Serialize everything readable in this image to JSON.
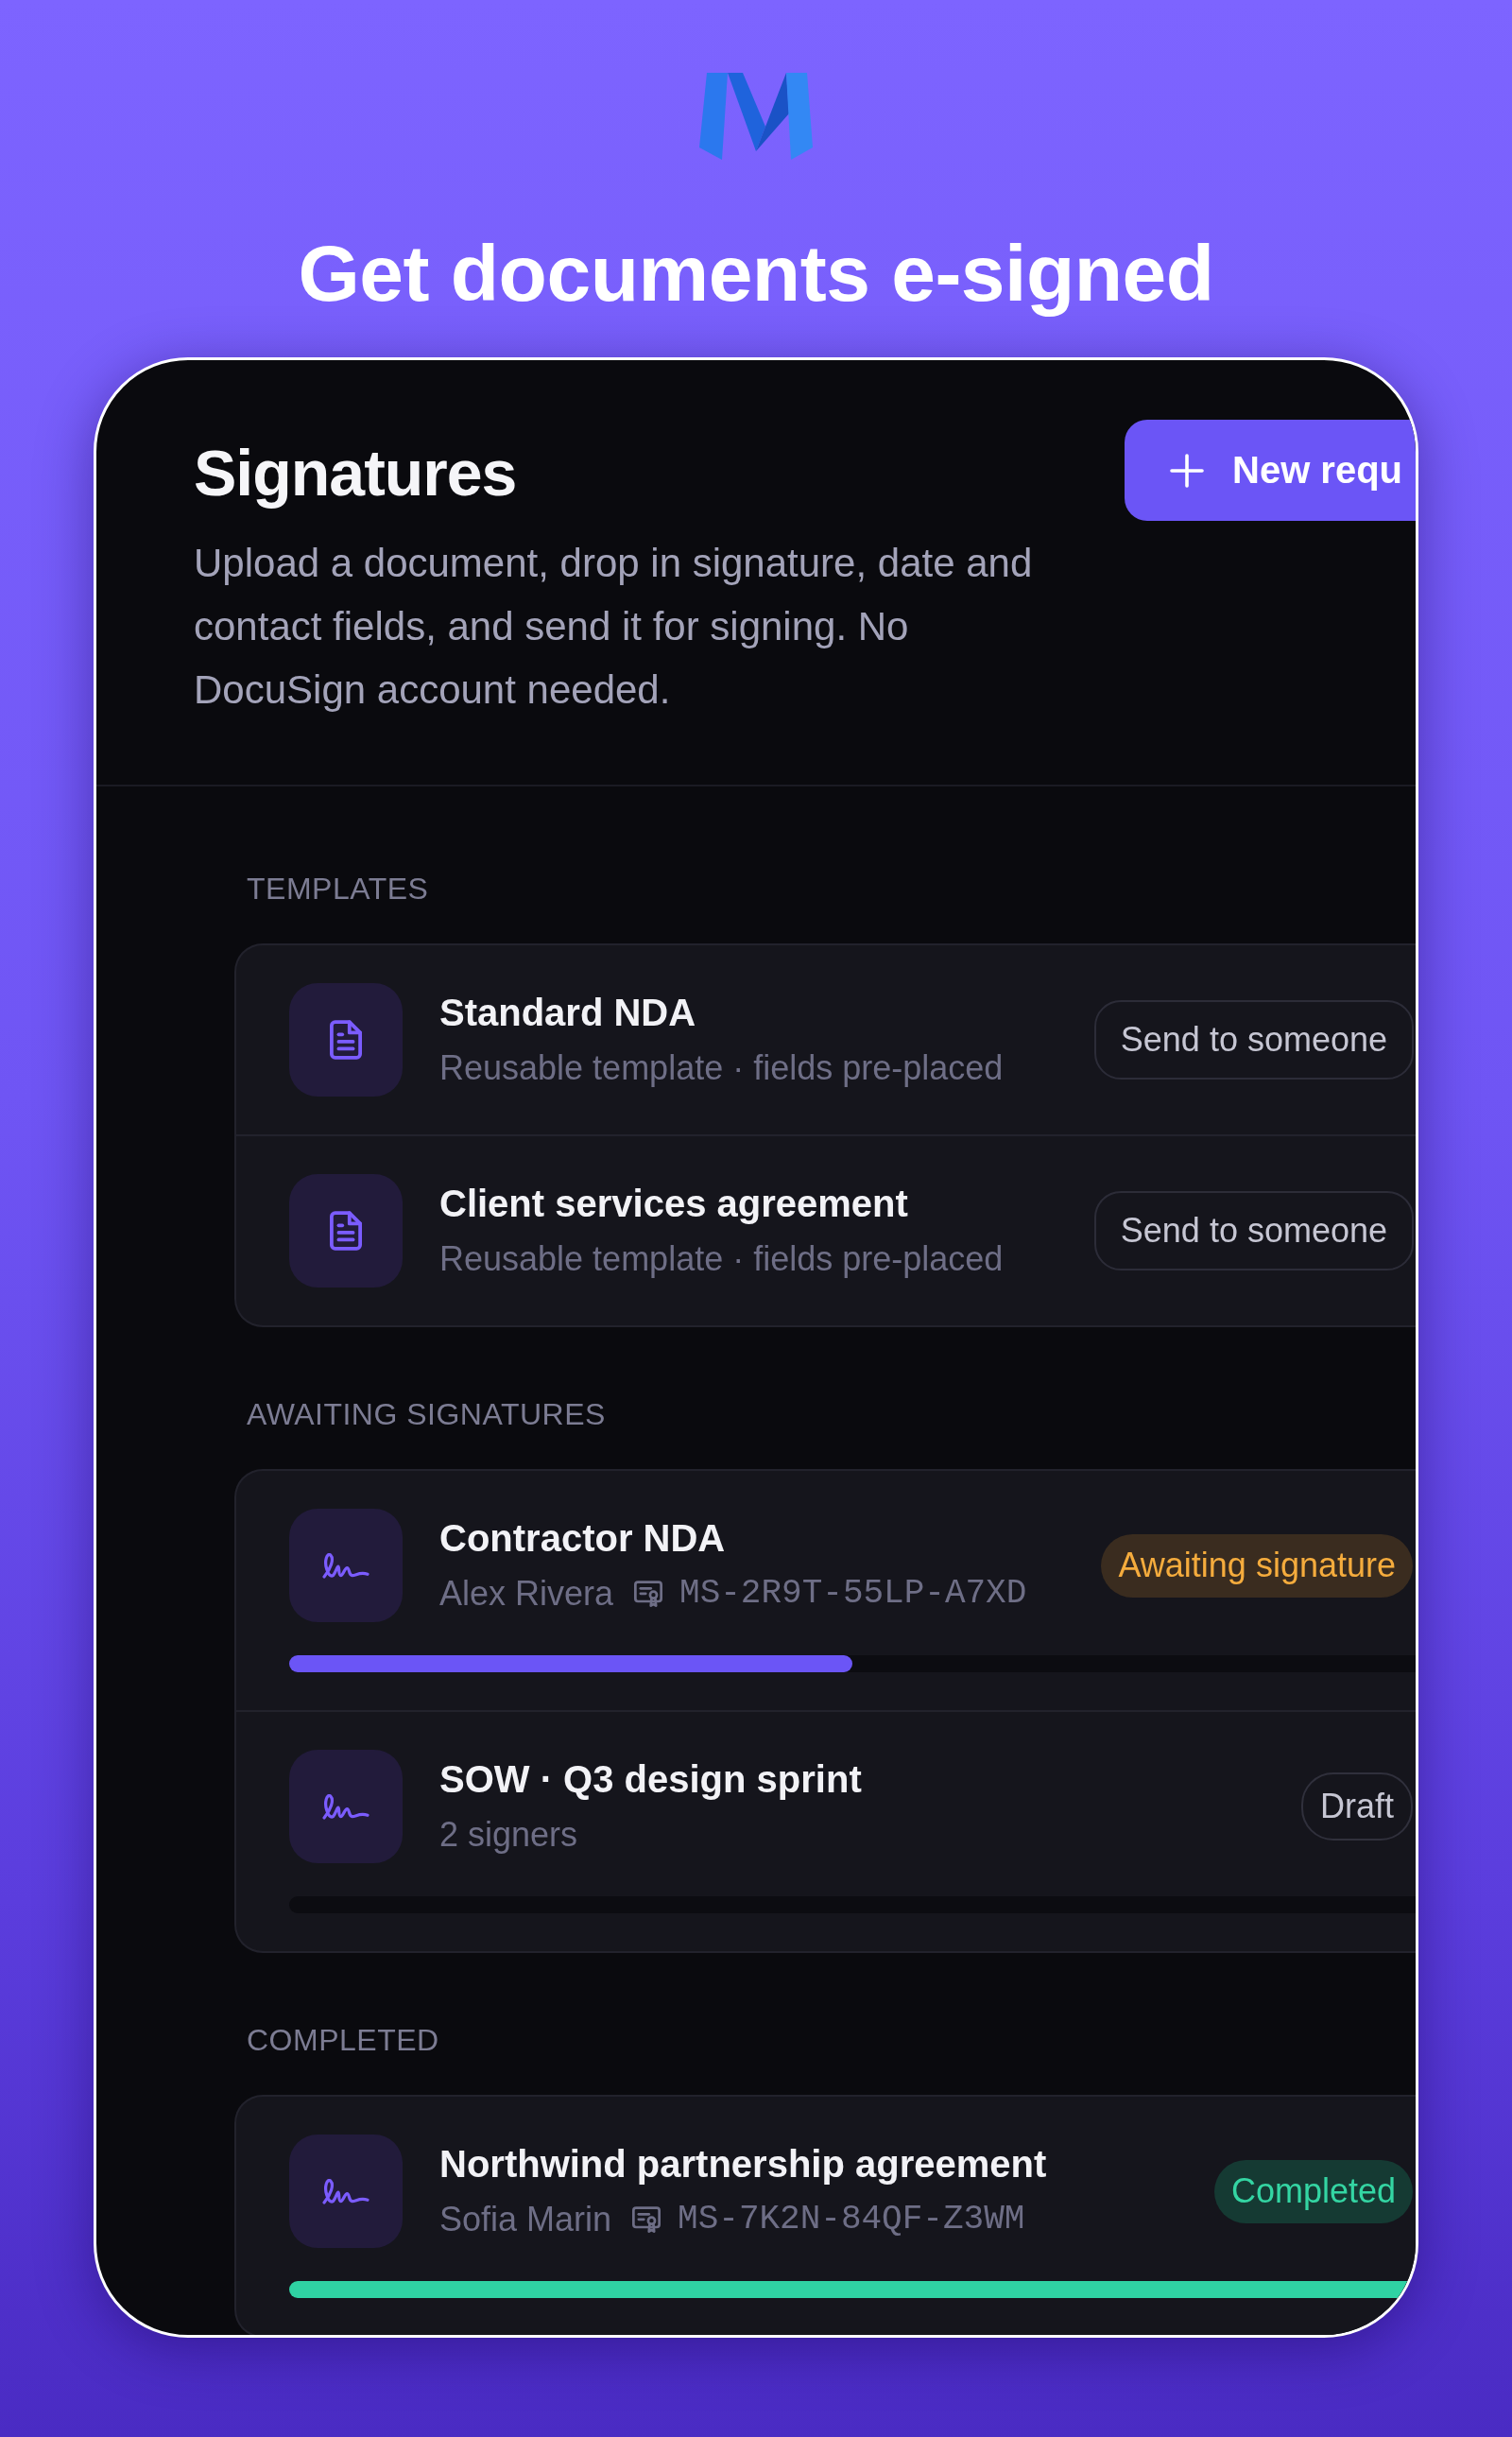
{
  "headline": "Get documents e-signed",
  "screen": {
    "title": "Signatures",
    "description": "Upload a document, drop in signature, date and contact fields, and send it for signing. No DocuSign account needed.",
    "new_button": "New requ",
    "sections": [
      {
        "heading": "TEMPLATES",
        "kind": "templates",
        "items": [
          {
            "title": "Standard NDA",
            "subtitle": "Reusable template · fields pre-placed",
            "action": "Send to someone"
          },
          {
            "title": "Client services agreement",
            "subtitle": "Reusable template · fields pre-placed",
            "action": "Send to someone"
          }
        ]
      },
      {
        "heading": "AWAITING SIGNATURES",
        "kind": "requests",
        "items": [
          {
            "title": "Contractor NDA",
            "signers": "Alex Rivera",
            "envelope_id": "MS-2R9T-55LP-A7XD",
            "status": {
              "label": "Awaiting signature",
              "kind": "awaiting"
            },
            "level": 0.5
          },
          {
            "title": "SOW · Q3 design sprint",
            "signers": "2 signers",
            "status": {
              "label": "Draft",
              "kind": "draft"
            },
            "level": 0
          }
        ]
      },
      {
        "heading": "COMPLETED",
        "kind": "requests",
        "items": [
          {
            "title": "Northwind partnership agreement",
            "signers": "Sofia Marin",
            "envelope_id": "MS-7K2N-84QF-Z3WM",
            "status": {
              "label": "Completed",
              "kind": "completed"
            },
            "level": 1
          }
        ]
      }
    ]
  }
}
